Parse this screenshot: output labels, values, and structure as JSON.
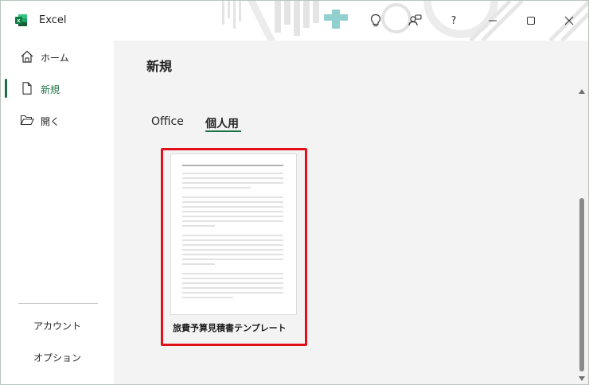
{
  "app": {
    "name": "Excel",
    "icon": "excel-icon",
    "brand_color": "#1e7145"
  },
  "titlebar": {
    "buttons": {
      "lightbulb": "lightbulb-icon",
      "feedback": "feedback-icon",
      "help": "?",
      "minimize": "minimize-icon",
      "maximize": "maximize-icon",
      "close": "close-icon"
    }
  },
  "sidebar": {
    "items": [
      {
        "label": "ホーム",
        "icon": "home-icon"
      },
      {
        "label": "新規",
        "icon": "new-document-icon",
        "active": true
      },
      {
        "label": "開く",
        "icon": "open-folder-icon"
      }
    ],
    "bottom": {
      "account": "アカウント",
      "options": "オプション"
    }
  },
  "main": {
    "title": "新規",
    "tabs": [
      {
        "label": "Office",
        "selected": false
      },
      {
        "label": "個人用",
        "selected": true
      }
    ],
    "templates": [
      {
        "name": "旅費予算見積書テンプレート",
        "highlighted": true
      }
    ],
    "highlight_color": "#e0101a"
  }
}
